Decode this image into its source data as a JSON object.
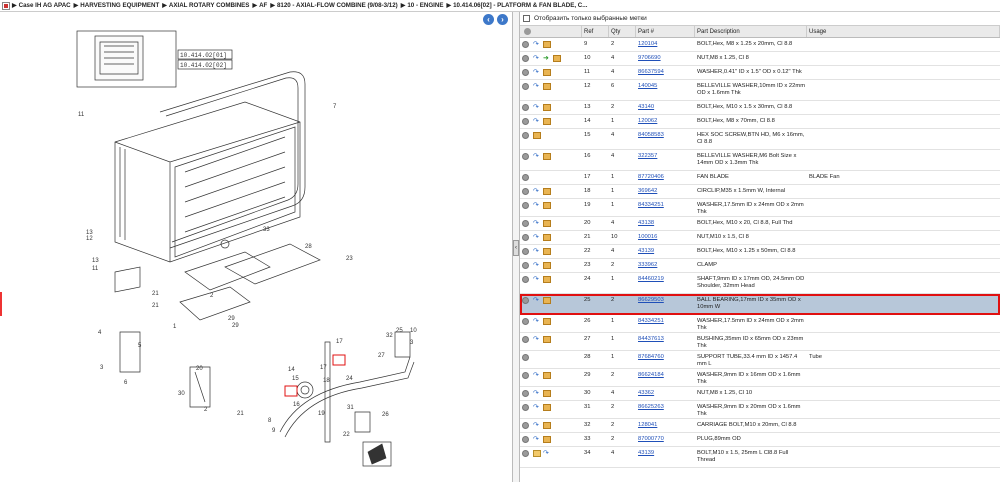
{
  "breadcrumb": [
    "Case IH AG APAC",
    "HARVESTING EQUIPMENT",
    "AXIAL ROTARY COMBINES",
    "AF",
    "8120 - AXIAL-FLOW COMBINE (9/08-3/12)",
    "10 - ENGINE",
    "10.414.06[02] - PLATFORM & FAN BLADE, C..."
  ],
  "diagram": {
    "inset_labels": [
      "10.414.02[01]",
      "10.414.02[02]"
    ],
    "callouts": [
      "7",
      "11",
      "12",
      "13",
      "11",
      "13",
      "33",
      "21",
      "21",
      "1",
      "29",
      "29",
      "30",
      "8",
      "9",
      "17",
      "14",
      "15",
      "16",
      "17",
      "18",
      "19",
      "24",
      "31",
      "32",
      "27",
      "25",
      "26",
      "28",
      "22",
      "23",
      "2",
      "2",
      "20",
      "21",
      "4",
      "3",
      "5",
      "6",
      "10",
      "3"
    ]
  },
  "filter": {
    "label": "Отобразить только выбранные метки"
  },
  "columns": {
    "ref": "Ref",
    "qty": "Qty",
    "part": "Part #",
    "desc": "Part Description",
    "usage": "Usage"
  },
  "rows": [
    {
      "ref": "9",
      "qty": "2",
      "part": "120104",
      "desc": "BOLT,Hex, M8 x 1.25 x 20mm, Cl 8.8",
      "usage": "",
      "icons": "cab"
    },
    {
      "ref": "10",
      "qty": "4",
      "part": "9706690",
      "desc": "NUT,M8 x 1.25, Cl 8",
      "usage": "",
      "icons": "cagb"
    },
    {
      "ref": "11",
      "qty": "4",
      "part": "86637594",
      "desc": "WASHER,0.41\" ID x 1.5\" OD x 0.12\" Thk",
      "usage": "",
      "icons": "cab"
    },
    {
      "ref": "12",
      "qty": "6",
      "part": "140045",
      "desc": "BELLEVILLE WASHER,10mm ID x 22mm OD x 1.6mm Thk",
      "usage": "",
      "icons": "cab"
    },
    {
      "ref": "13",
      "qty": "2",
      "part": "43140",
      "desc": "BOLT,Hex, M10 x 1.5 x 30mm, Cl 8.8",
      "usage": "",
      "icons": "cab"
    },
    {
      "ref": "14",
      "qty": "1",
      "part": "120062",
      "desc": "BOLT,Hex, M8 x 70mm, Cl 8.8",
      "usage": "",
      "icons": "cab"
    },
    {
      "ref": "15",
      "qty": "4",
      "part": "84058583",
      "desc": "HEX SOC SCREW,BTN HD, M6 x 16mm, Cl 8.8",
      "usage": "",
      "icons": "cb"
    },
    {
      "ref": "16",
      "qty": "4",
      "part": "322357",
      "desc": "BELLEVILLE WASHER,M6 Bolt Size x 14mm OD x 1.3mm Thk",
      "usage": "",
      "icons": "cab"
    },
    {
      "ref": "17",
      "qty": "1",
      "part": "87720406",
      "desc": "FAN BLADE",
      "usage": "BLADE Fan",
      "icons": "c"
    },
    {
      "ref": "18",
      "qty": "1",
      "part": "369642",
      "desc": "CIRCLIP,M35 x 1.5mm W, Internal",
      "usage": "",
      "icons": "cab"
    },
    {
      "ref": "19",
      "qty": "1",
      "part": "84334251",
      "desc": "WASHER,17.5mm ID x 24mm OD x 2mm Thk",
      "usage": "",
      "icons": "cab"
    },
    {
      "ref": "20",
      "qty": "4",
      "part": "43138",
      "desc": "BOLT,Hex, M10 x 20, Cl 8.8, Full Thd",
      "usage": "",
      "icons": "cab"
    },
    {
      "ref": "21",
      "qty": "10",
      "part": "100016",
      "desc": "NUT,M10 x 1.5, Cl 8",
      "usage": "",
      "icons": "cab"
    },
    {
      "ref": "22",
      "qty": "4",
      "part": "43139",
      "desc": "BOLT,Hex, M10 x 1.25 x 50mm, Cl 8.8",
      "usage": "",
      "icons": "cab"
    },
    {
      "ref": "23",
      "qty": "2",
      "part": "333962",
      "desc": "CLAMP",
      "usage": "",
      "icons": "cab"
    },
    {
      "ref": "24",
      "qty": "1",
      "part": "84460219",
      "desc": "SHAFT,9mm ID x 17mm OD, 24.5mm OD Shoulder, 32mm Head",
      "usage": "",
      "icons": "cab"
    },
    {
      "ref": "25",
      "qty": "2",
      "part": "86629503",
      "desc": "BALL BEARING,17mm ID x 35mm OD x 10mm W",
      "usage": "",
      "icons": "cab",
      "selected": true
    },
    {
      "ref": "26",
      "qty": "1",
      "part": "84334251",
      "desc": "WASHER,17.5mm ID x 24mm OD x 2mm Thk",
      "usage": "",
      "icons": "cab"
    },
    {
      "ref": "27",
      "qty": "1",
      "part": "84437613",
      "desc": "BUSHING,35mm ID x 65mm OD x 23mm Thk",
      "usage": "",
      "icons": "cab"
    },
    {
      "ref": "28",
      "qty": "1",
      "part": "87684760",
      "desc": "SUPPORT TUBE,33.4 mm ID x 1457.4 mm L",
      "usage": "Tube",
      "icons": "c"
    },
    {
      "ref": "29",
      "qty": "2",
      "part": "86624184",
      "desc": "WASHER,9mm ID x 16mm OD x 1.6mm Thk",
      "usage": "",
      "icons": "cab"
    },
    {
      "ref": "30",
      "qty": "4",
      "part": "43362",
      "desc": "NUT,M8 x 1.25, Cl 10",
      "usage": "",
      "icons": "cab"
    },
    {
      "ref": "31",
      "qty": "2",
      "part": "86625263",
      "desc": "WASHER,9mm ID x 20mm OD x 1.6mm Thk",
      "usage": "",
      "icons": "cab"
    },
    {
      "ref": "32",
      "qty": "2",
      "part": "128041",
      "desc": "CARRIAGE BOLT,M10 x 20mm, Cl 8.8",
      "usage": "",
      "icons": "cab"
    },
    {
      "ref": "33",
      "qty": "2",
      "part": "87000770",
      "desc": "PLUG,89mm OD",
      "usage": "",
      "icons": "cab"
    },
    {
      "ref": "34",
      "qty": "4",
      "part": "43139",
      "desc": "BOLT,M10 x 1.5, 25mm L Cl8.8 Full Thread",
      "usage": "",
      "icons": "cfa"
    }
  ]
}
